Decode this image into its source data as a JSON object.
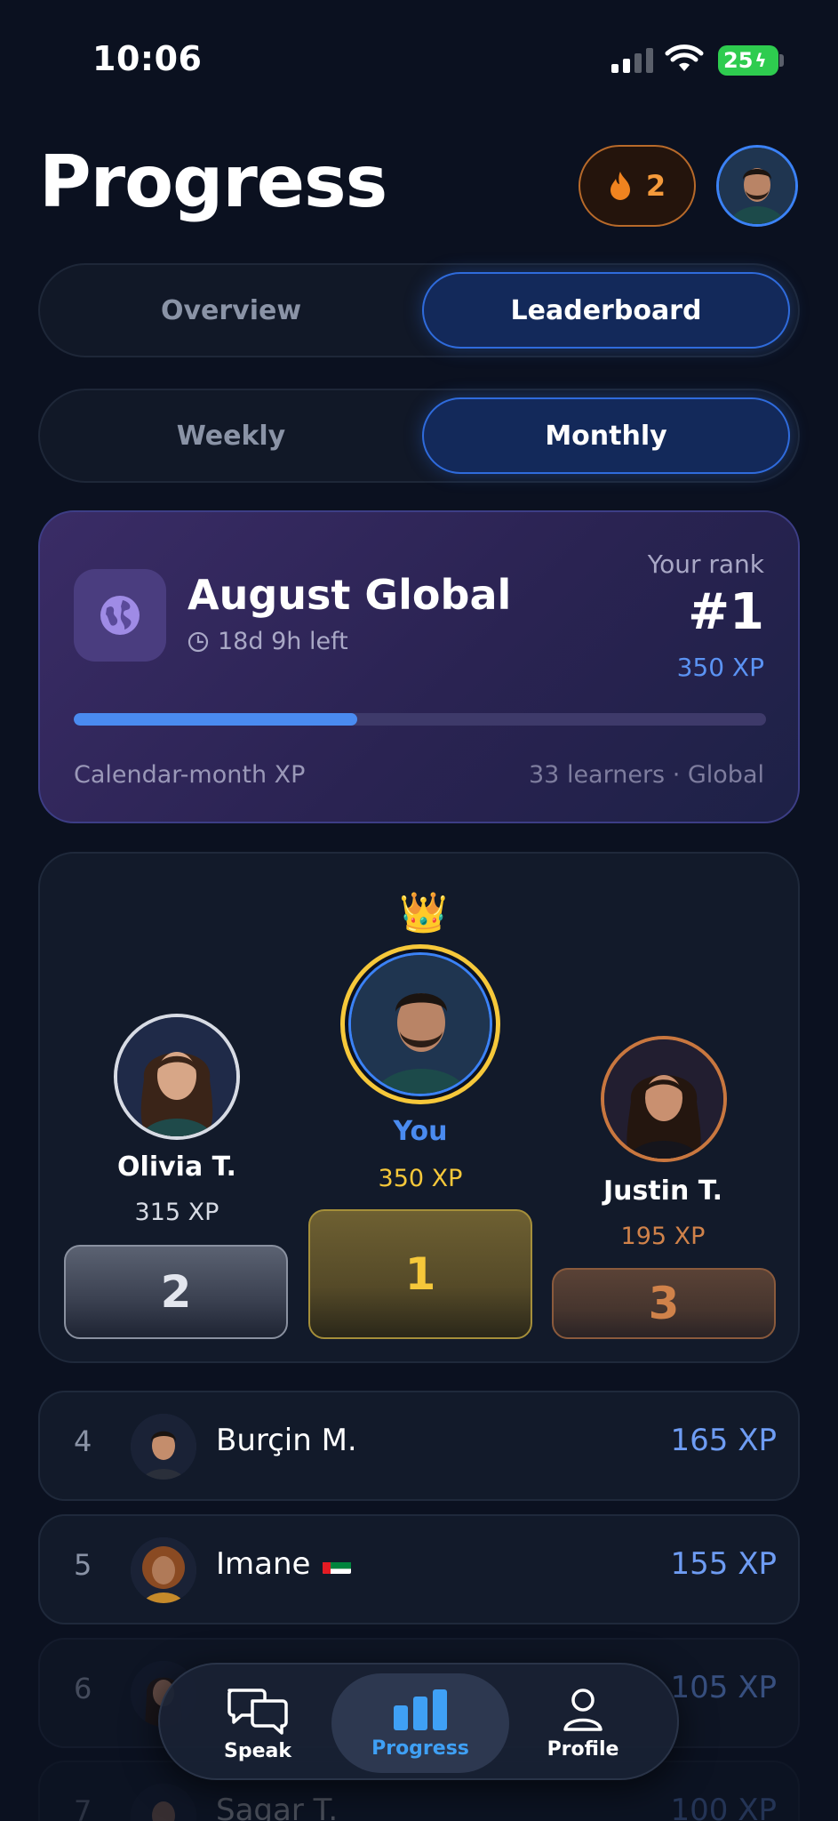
{
  "status_bar": {
    "time": "10:06",
    "battery": "25"
  },
  "header": {
    "title": "Progress",
    "streak_count": "2"
  },
  "tabs": [
    {
      "label": "Overview",
      "active": false
    },
    {
      "label": "Leaderboard",
      "active": true
    }
  ],
  "period": [
    {
      "label": "Weekly",
      "active": false
    },
    {
      "label": "Monthly",
      "active": true
    }
  ],
  "competition": {
    "title": "August Global",
    "time_left": "18d 9h left",
    "rank_label": "Your rank",
    "rank": "#1",
    "xp": "350 XP",
    "progress_fraction": 0.41,
    "footer_left": "Calendar-month XP",
    "footer_right": "33 learners · Global"
  },
  "podium": {
    "first": {
      "name": "You",
      "xp": "350 XP",
      "place": "1"
    },
    "second": {
      "name": "Olivia T.",
      "xp": "315 XP",
      "place": "2"
    },
    "third": {
      "name": "Justin T.",
      "xp": "195 XP",
      "place": "3"
    }
  },
  "leaderboard": [
    {
      "rank": "4",
      "name": "Burçin M.",
      "xp": "165 XP"
    },
    {
      "rank": "5",
      "name": "Imane",
      "xp": "155 XP"
    },
    {
      "rank": "6",
      "name": "",
      "xp": "105 XP"
    },
    {
      "rank": "7",
      "name": "Sagar T.",
      "xp": "100 XP"
    }
  ],
  "nav": [
    {
      "label": "Speak",
      "icon": "chat-bubbles-icon"
    },
    {
      "label": "Progress",
      "icon": "bar-chart-icon",
      "active": true
    },
    {
      "label": "Profile",
      "icon": "person-icon"
    }
  ],
  "colors": {
    "background": "#0b1120",
    "accent": "#3b82f6",
    "gold": "#f6c83a",
    "silver": "#d7dbe4",
    "bronze": "#c9773f",
    "streak": "#f59a3b"
  }
}
